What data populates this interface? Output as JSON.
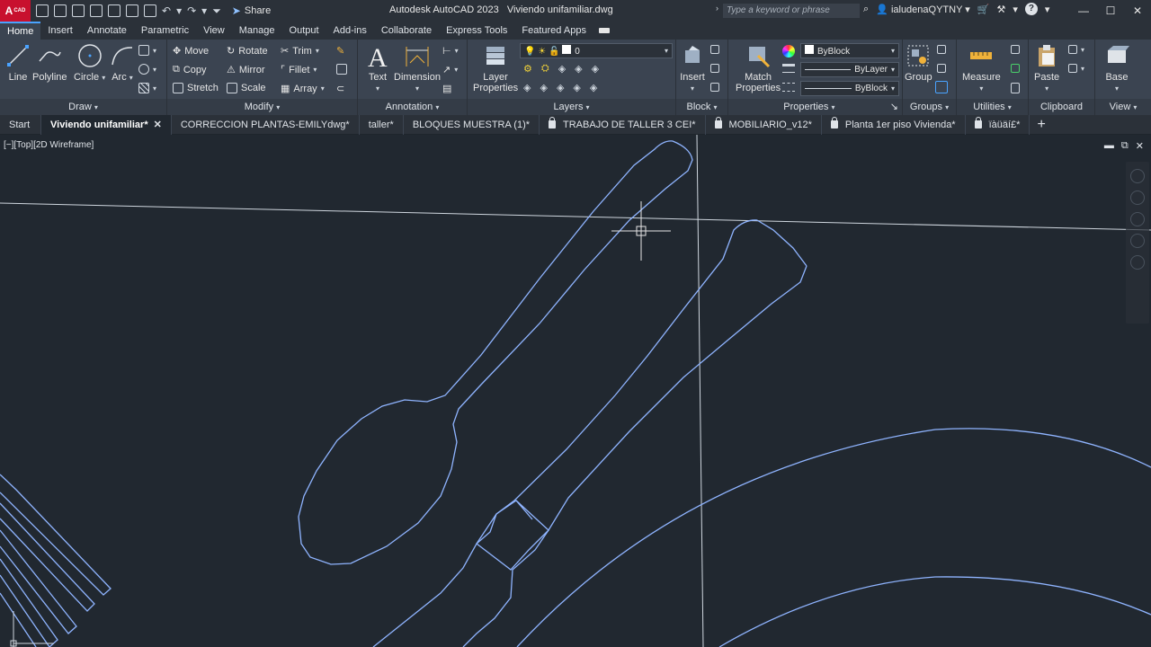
{
  "titlebar": {
    "logo": "A",
    "logo_sub": "CAD",
    "share_label": "Share",
    "app_title": "Autodesk AutoCAD 2023",
    "file_title": "Viviendo unifamiliar.dwg",
    "search_placeholder": "Type a keyword or phrase",
    "user": "ialudenaQYTNY",
    "help": "?"
  },
  "ribbon_tabs": [
    "Home",
    "Insert",
    "Annotate",
    "Parametric",
    "View",
    "Manage",
    "Output",
    "Add-ins",
    "Collaborate",
    "Express Tools",
    "Featured Apps"
  ],
  "ribbon": {
    "draw": {
      "label": "Draw",
      "line": "Line",
      "polyline": "Polyline",
      "circle": "Circle",
      "arc": "Arc"
    },
    "modify": {
      "label": "Modify",
      "move": "Move",
      "rotate": "Rotate",
      "trim": "Trim",
      "copy": "Copy",
      "mirror": "Mirror",
      "fillet": "Fillet",
      "stretch": "Stretch",
      "scale": "Scale",
      "array": "Array"
    },
    "annotation": {
      "label": "Annotation",
      "text": "Text",
      "dimension": "Dimension"
    },
    "layers": {
      "label": "Layers",
      "layer_properties_1": "Layer",
      "layer_properties_2": "Properties",
      "current_layer": "0"
    },
    "block": {
      "label": "Block",
      "insert": "Insert"
    },
    "properties": {
      "label": "Properties",
      "match_1": "Match",
      "match_2": "Properties",
      "color": "ByBlock",
      "linetype": "ByLayer",
      "lineweight": "ByBlock"
    },
    "groups": {
      "label": "Groups",
      "group": "Group"
    },
    "utilities": {
      "label": "Utilities",
      "measure": "Measure"
    },
    "clipboard": {
      "label": "Clipboard",
      "paste": "Paste"
    },
    "view": {
      "label": "View",
      "base": "Base"
    }
  },
  "file_tabs": [
    {
      "label": "Start",
      "locked": false,
      "active": false
    },
    {
      "label": "Viviendo unifamiliar*",
      "locked": false,
      "active": true
    },
    {
      "label": "CORRECCION PLANTAS-EMILYdwg*",
      "locked": false,
      "active": false
    },
    {
      "label": "taller*",
      "locked": false,
      "active": false
    },
    {
      "label": "BLOQUES MUESTRA (1)*",
      "locked": false,
      "active": false
    },
    {
      "label": "TRABAJO DE TALLER 3 CEI*",
      "locked": true,
      "active": false
    },
    {
      "label": "MOBILIARIO_v12*",
      "locked": true,
      "active": false
    },
    {
      "label": "Planta 1er piso Vivienda*",
      "locked": true,
      "active": false
    },
    {
      "label": "ïàüäí£*",
      "locked": true,
      "active": false
    }
  ],
  "viewport": {
    "label": "[−][Top][2D Wireframe]"
  },
  "colors": {
    "background": "#212830",
    "geometry": "#8fb4ff",
    "crosshair": "#e6e6e6",
    "ribbon": "#3b4451"
  }
}
